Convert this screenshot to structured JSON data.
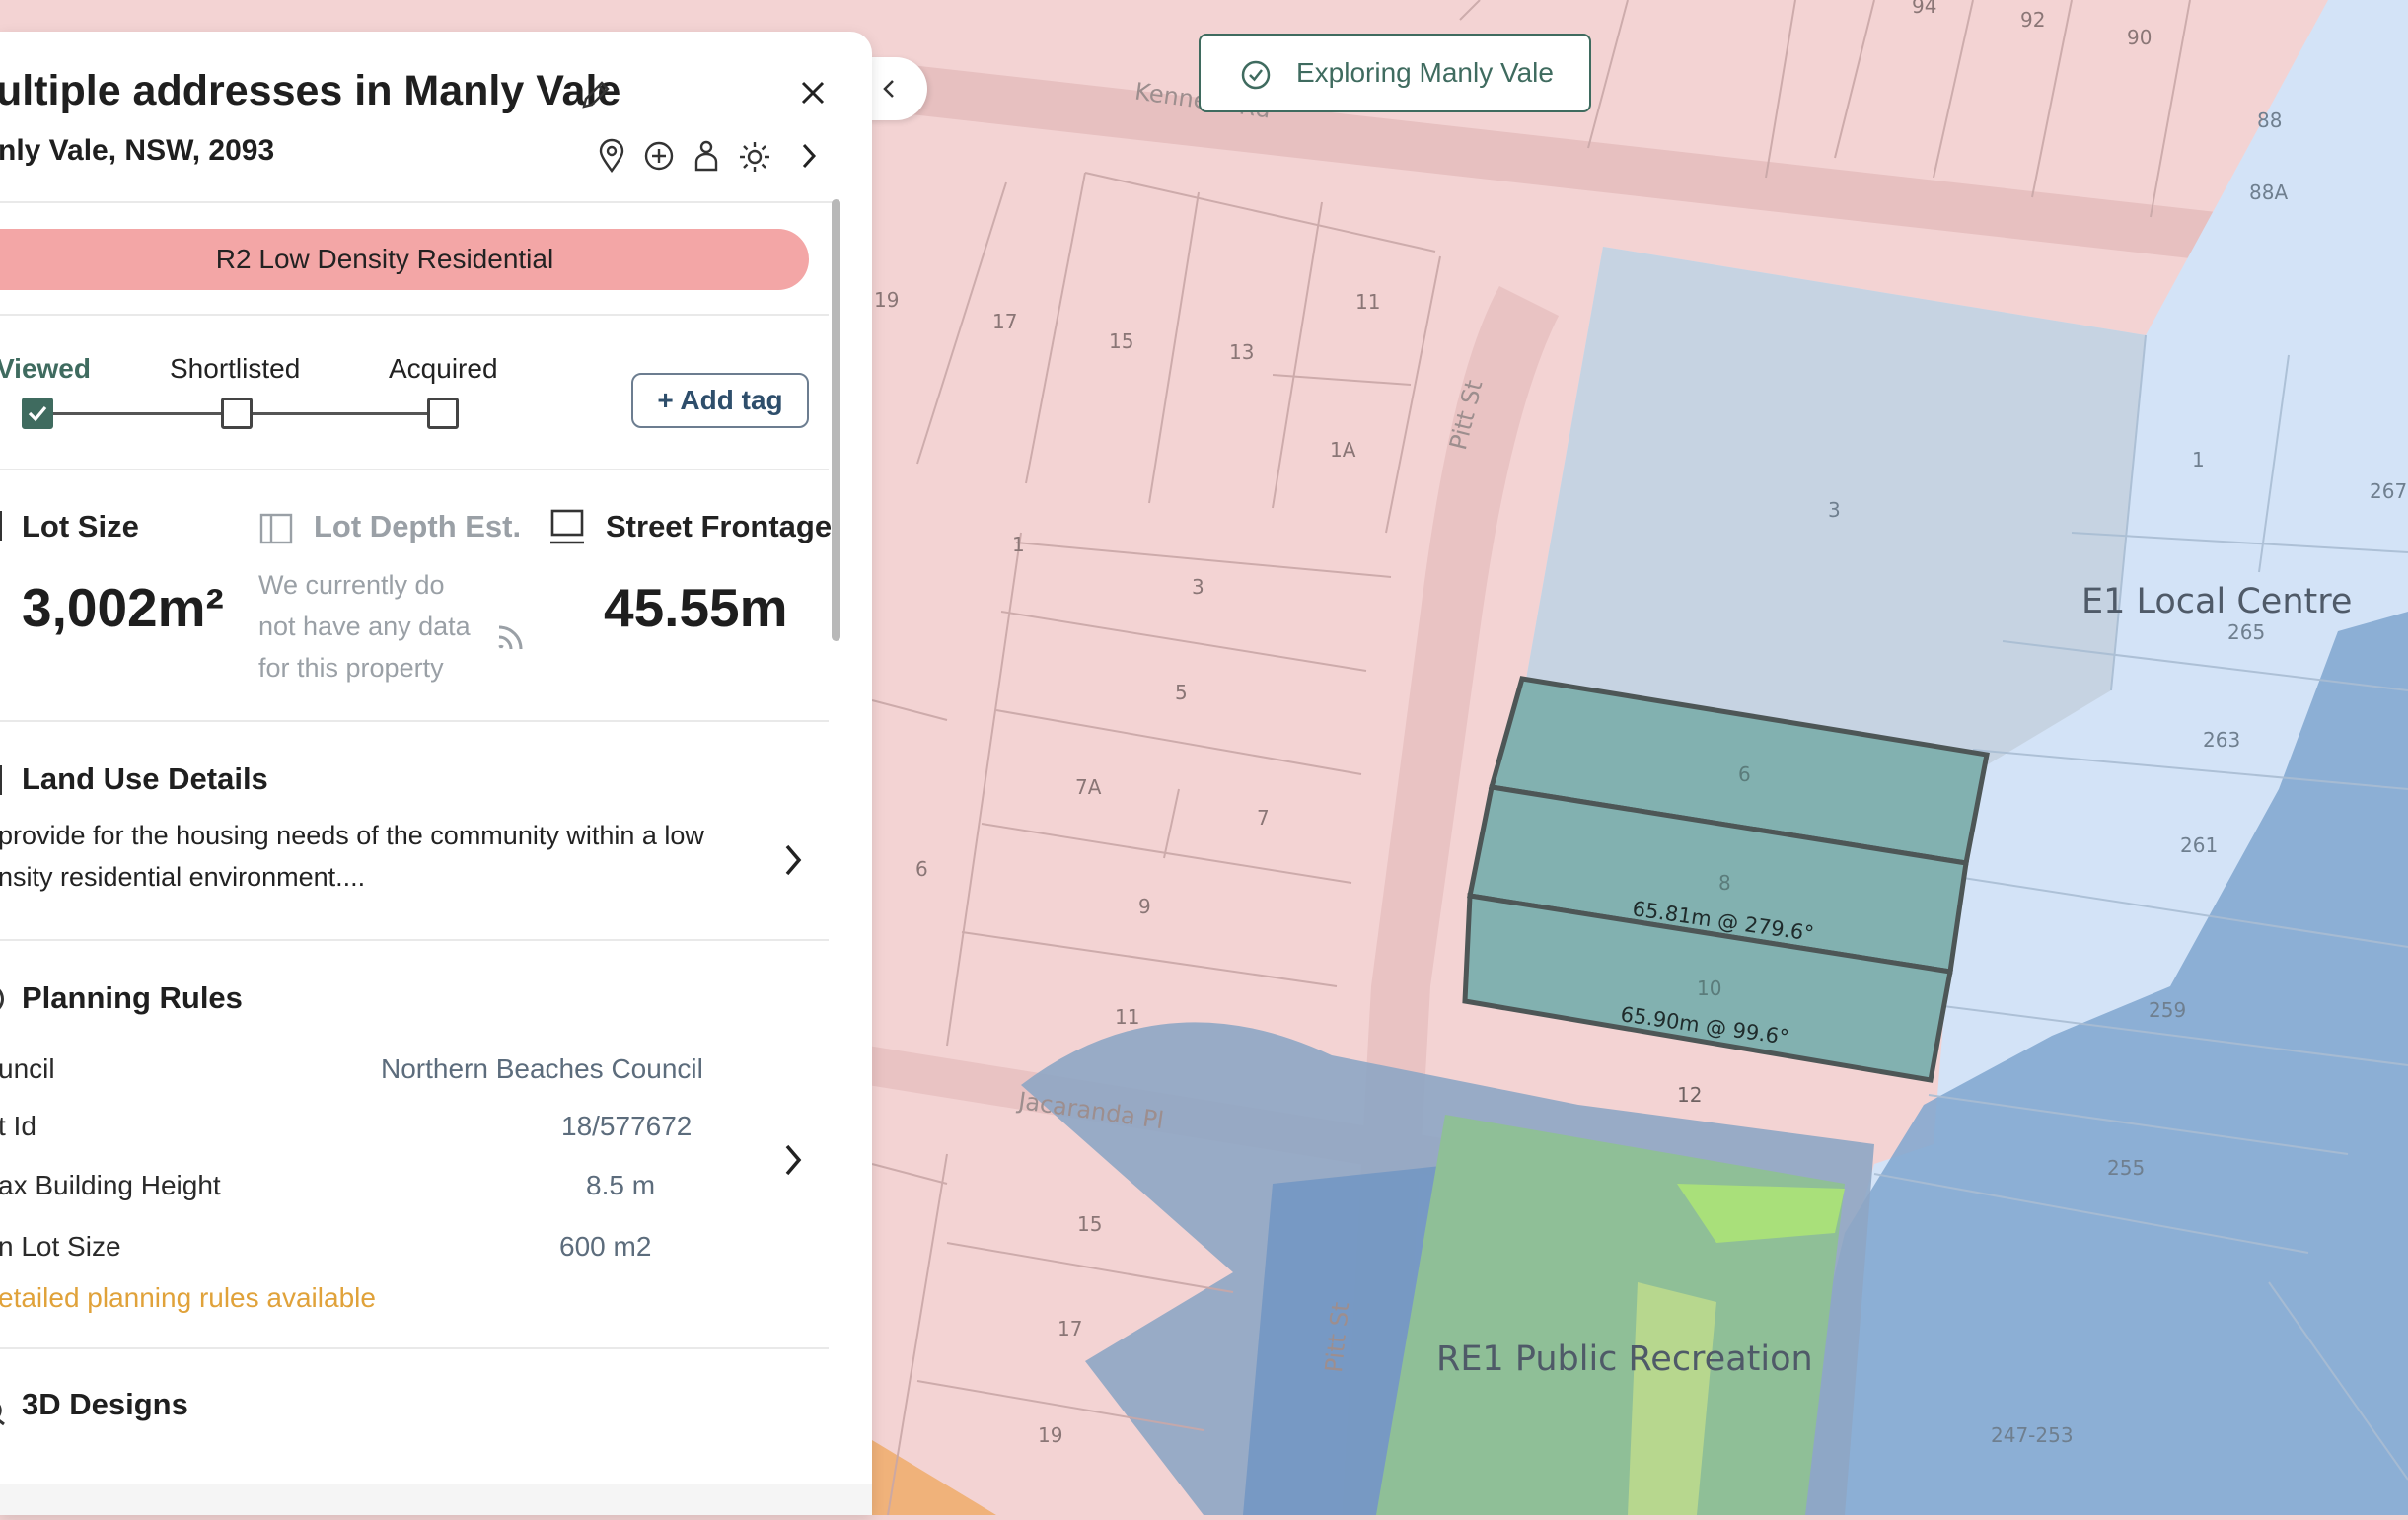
{
  "header": {
    "title": "ultiple addresses in Manly Vale",
    "subtitle": "nly Vale, NSW, 2093"
  },
  "zone_pill": "R2 Low Density Residential",
  "tags": {
    "steps": [
      "Viewed",
      "Shortlisted",
      "Acquired"
    ],
    "checked": [
      true,
      false,
      false
    ],
    "add_label": "+ Add tag"
  },
  "metrics": {
    "lot_size_label": "Lot Size",
    "lot_size_value": "3,002m²",
    "lot_depth_label": "Lot Depth Est.",
    "lot_depth_note_1": "We currently do",
    "lot_depth_note_2": "not have any data",
    "lot_depth_note_3": "for this property",
    "frontage_label": "Street Frontage",
    "frontage_value": "45.55m"
  },
  "land_use": {
    "heading": "Land Use Details",
    "line1": "provide for the housing needs of the community within a low",
    "line2": "nsity residential environment...."
  },
  "planning": {
    "heading": "Planning Rules",
    "rows": [
      {
        "label": "uncil",
        "value": "Northern Beaches Council"
      },
      {
        "label": "t Id",
        "value": "18/577672"
      },
      {
        "label": "ax Building Height",
        "value": "8.5 m"
      },
      {
        "label": "n Lot Size",
        "value": "600 m2"
      }
    ],
    "more_link": "etailed planning rules available"
  },
  "designs": {
    "heading": "3D Designs"
  },
  "explore_badge": "Exploring Manly Vale",
  "colors": {
    "residential": "#f3d3d3",
    "local_centre": "#d3e3f7",
    "recreation": "#8fbf97",
    "selection": "#82b1b0",
    "accent_green": "#3f6b5f",
    "link_orange": "#e0a23a"
  },
  "map": {
    "zone_labels": {
      "local_centre": "E1 Local Centre",
      "recreation": "RE1 Public Recreation"
    },
    "roads": {
      "kenneth": "Kenneth Rd",
      "pitt_north": "Pitt St",
      "pitt_south": "Pitt St",
      "jacaranda": "Jacaranda Pl"
    },
    "lots": [
      "94",
      "92",
      "90",
      "88",
      "88A",
      "19",
      "17",
      "15",
      "13",
      "11",
      "1A",
      "3",
      "1",
      "267",
      "265",
      "263",
      "261",
      "259",
      "255",
      "247-253",
      "1",
      "3",
      "5",
      "7A",
      "7",
      "6",
      "9",
      "11",
      "6",
      "8",
      "10",
      "12",
      "15",
      "17",
      "19"
    ],
    "measurements": [
      "65.81m @ 279.6°",
      "65.90m @ 99.6°"
    ]
  }
}
